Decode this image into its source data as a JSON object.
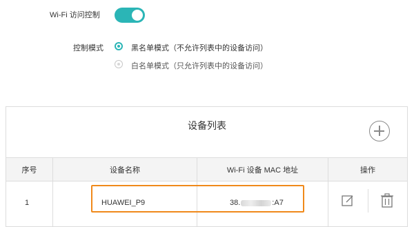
{
  "settings": {
    "wifi_access_control_label": "Wi-Fi 访问控制",
    "wifi_access_control_on": true,
    "control_mode_label": "控制模式",
    "mode_options": [
      {
        "label": "黑名单模式（不允许列表中的设备访问）",
        "selected": true
      },
      {
        "label": "白名单模式（只允许列表中的设备访问）",
        "selected": false
      }
    ]
  },
  "device_list": {
    "title": "设备列表",
    "columns": {
      "index": "序号",
      "device_name": "设备名称",
      "mac": "Wi-Fi 设备 MAC 地址",
      "actions": "操作"
    },
    "rows": [
      {
        "index": "1",
        "device_name": "HUAWEI_P9",
        "mac_prefix": "38.",
        "mac_suffix": ":A7"
      }
    ]
  },
  "icons": {
    "add": "add-circle-icon",
    "edit": "edit-icon",
    "delete": "trash-icon"
  },
  "colors": {
    "accent": "#2bb5b6",
    "highlight": "#f0891a",
    "header_bg": "#f4f4f4",
    "border": "#dcdcdc"
  }
}
